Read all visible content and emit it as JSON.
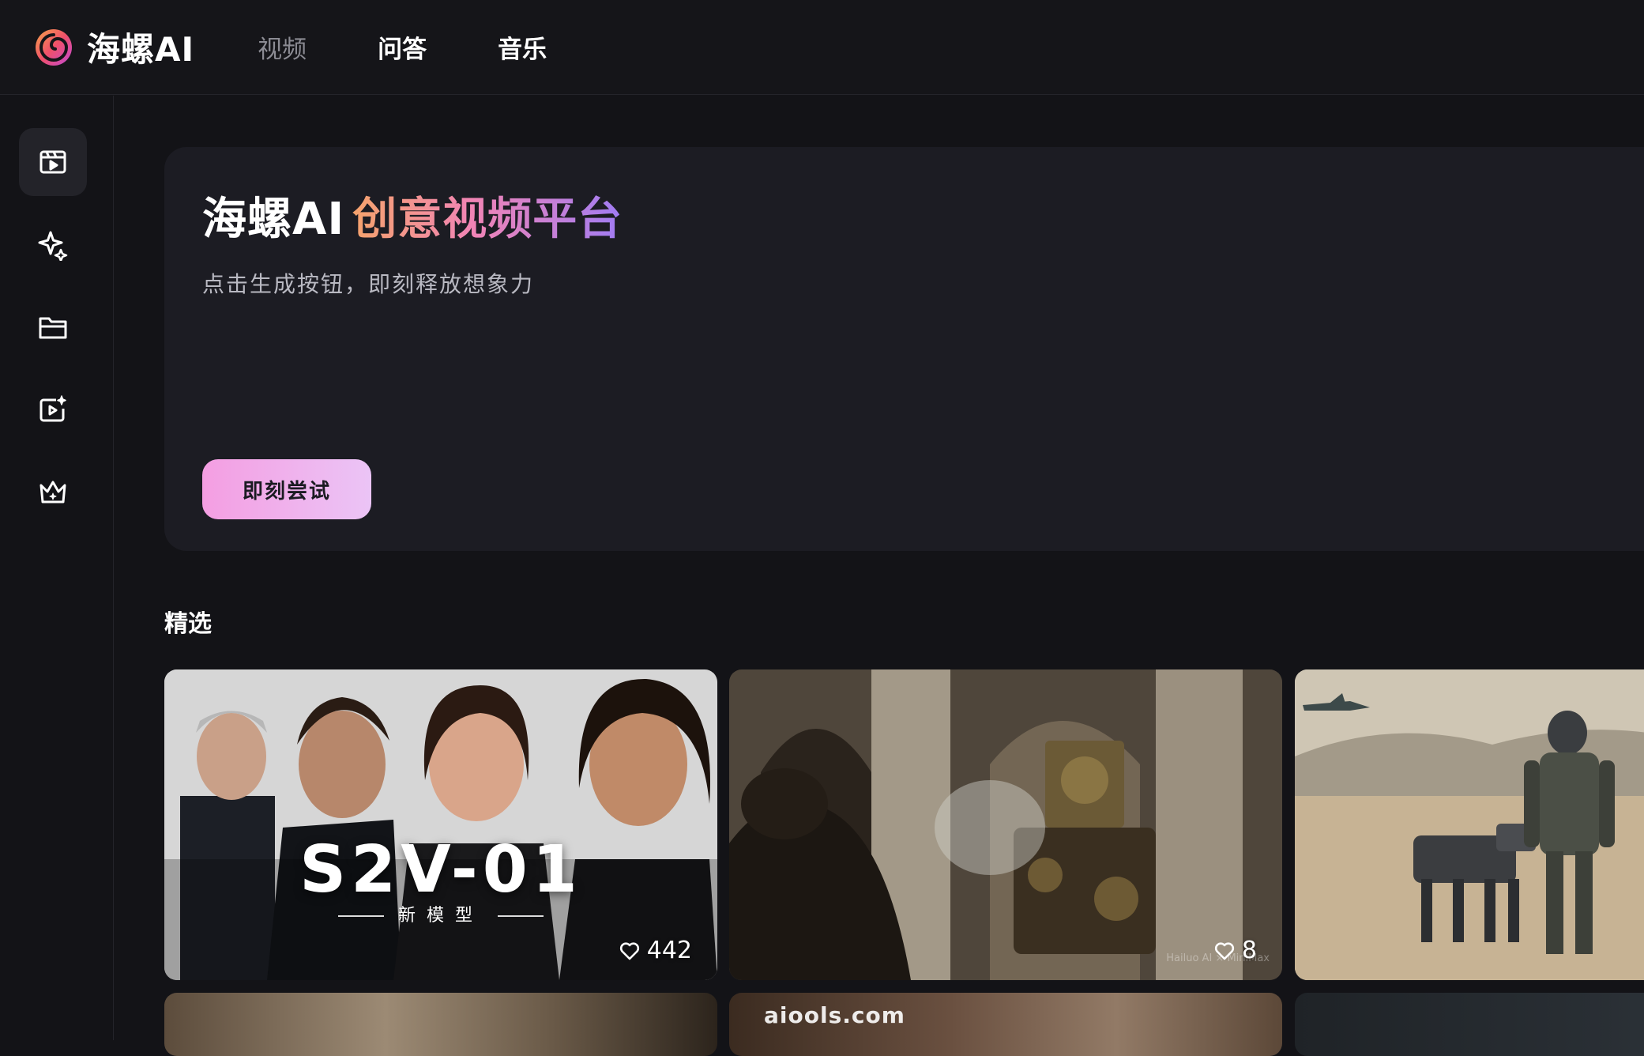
{
  "header": {
    "logo_text": "海螺AI",
    "nav": [
      {
        "label": "视频"
      },
      {
        "label": "问答"
      },
      {
        "label": "音乐"
      }
    ]
  },
  "sidebar": {
    "items": [
      {
        "icon": "video-player-icon",
        "active": true
      },
      {
        "icon": "sparkle-icon",
        "active": false
      },
      {
        "icon": "folder-icon",
        "active": false
      },
      {
        "icon": "video-sparkle-icon",
        "active": false
      },
      {
        "icon": "crown-icon",
        "active": false
      }
    ]
  },
  "hero": {
    "title_brand": "海螺AI",
    "title_highlight": "创意视频平台",
    "subtitle": "点击生成按钮，即刻释放想象力",
    "cta_label": "即刻尝试",
    "cta_gradient": [
      "#f49ee2",
      "#ebc4f6"
    ],
    "highlight_gradient": [
      "#f5a36c",
      "#f184b6",
      "#a07cf4"
    ]
  },
  "featured": {
    "title": "精选",
    "cards": [
      {
        "overlay_title": "S2V-01",
        "overlay_sub": "新模型",
        "likes": "442"
      },
      {
        "overlay_title": "",
        "overlay_sub": "",
        "likes": "8",
        "watermark": "Hailuo AI × MiniMax"
      },
      {
        "overlay_title": "",
        "overlay_sub": "",
        "likes": ""
      }
    ]
  },
  "site_watermark": "aiools.com"
}
